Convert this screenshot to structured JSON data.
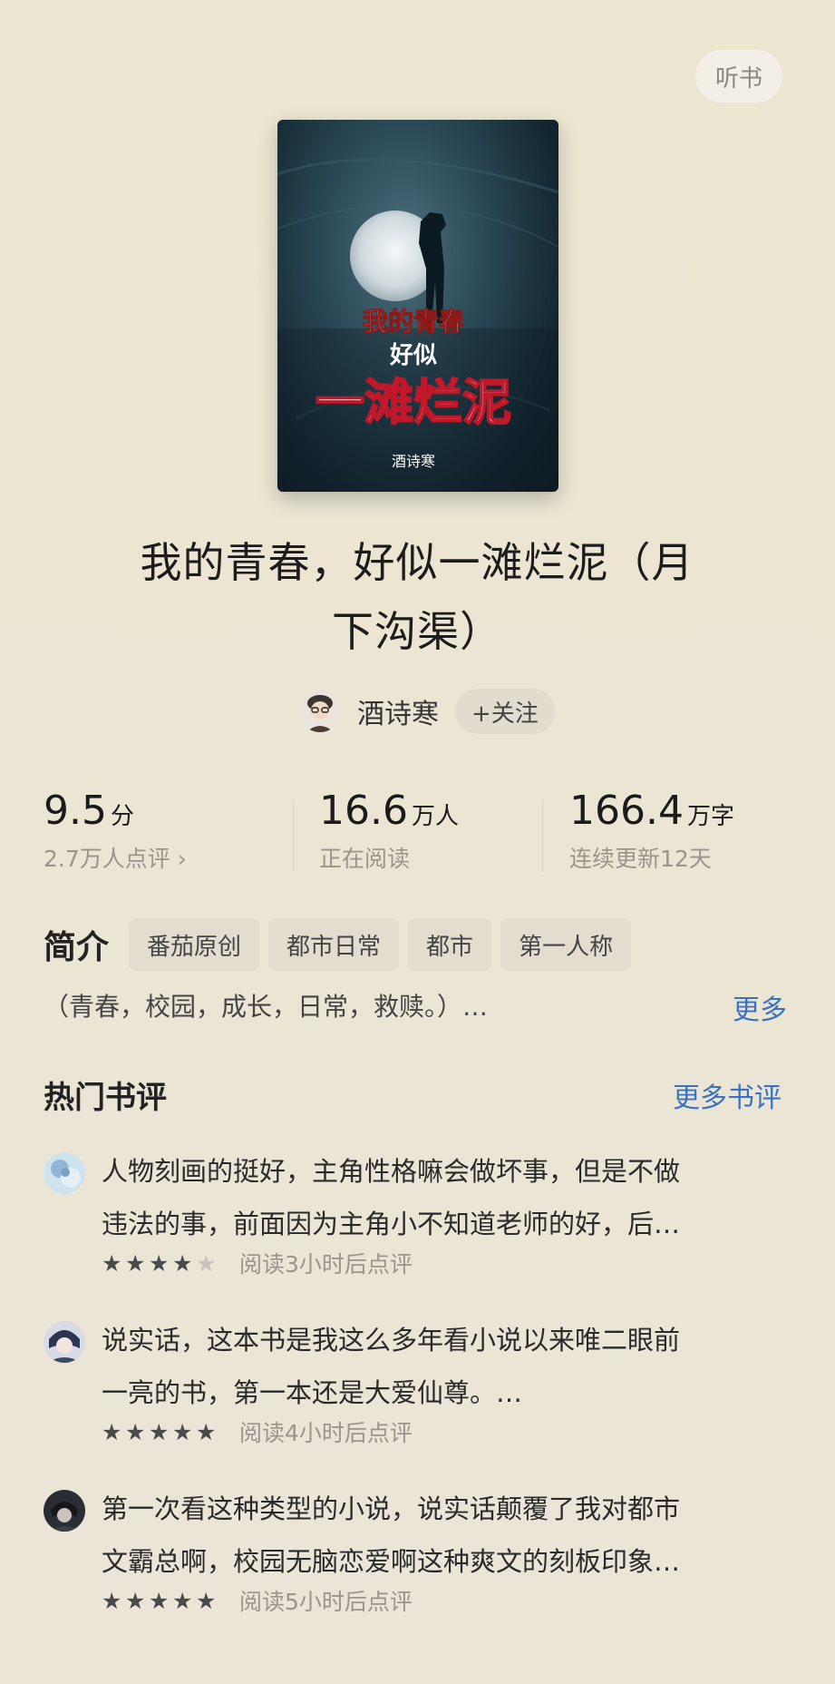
{
  "header": {
    "listen_label": "听书"
  },
  "book": {
    "cover_title_line1": "我的青春",
    "cover_title_line2": "好似",
    "cover_title_line3": "一滩烂泥",
    "cover_author": "酒诗寒",
    "title_line1": "我的青春，好似一滩烂泥（月",
    "title_line2": "下沟渠）"
  },
  "author": {
    "name": "酒诗寒",
    "follow_label": "+关注"
  },
  "stats": [
    {
      "value": "9.5",
      "unit": "分",
      "sub": "2.7万人点评 ›"
    },
    {
      "value": "16.6",
      "unit": "万人",
      "sub": "正在阅读"
    },
    {
      "value": "166.4",
      "unit": "万字",
      "sub": "连续更新12天"
    }
  ],
  "intro": {
    "label": "简介",
    "tags": [
      "番茄原创",
      "都市日常",
      "都市",
      "第一人称"
    ],
    "text": "（青春，校园，成长，日常，救赎。）…",
    "more_label": "更多"
  },
  "reviews_section": {
    "title": "热门书评",
    "more_label": "更多书评",
    "items": [
      {
        "line1": "人物刻画的挺好，主角性格嘛会做坏事，但是不做",
        "line2": "违法的事，前面因为主角小不知道老师的好，后…",
        "rating": 4,
        "meta": "阅读3小时后点评"
      },
      {
        "line1": "说实话，这本书是我这么多年看小说以来唯二眼前",
        "line2": "一亮的书，第一本还是大爱仙尊。…",
        "rating": 5,
        "meta": "阅读4小时后点评"
      },
      {
        "line1": "第一次看这种类型的小说，说实话颠覆了我对都市",
        "line2": "文霸总啊，校园无脑恋爱啊这种爽文的刻板印象…",
        "rating": 5,
        "meta": "阅读5小时后点评"
      }
    ]
  },
  "colors": {
    "link": "#3a72c0",
    "background": "#ebe5d5"
  }
}
